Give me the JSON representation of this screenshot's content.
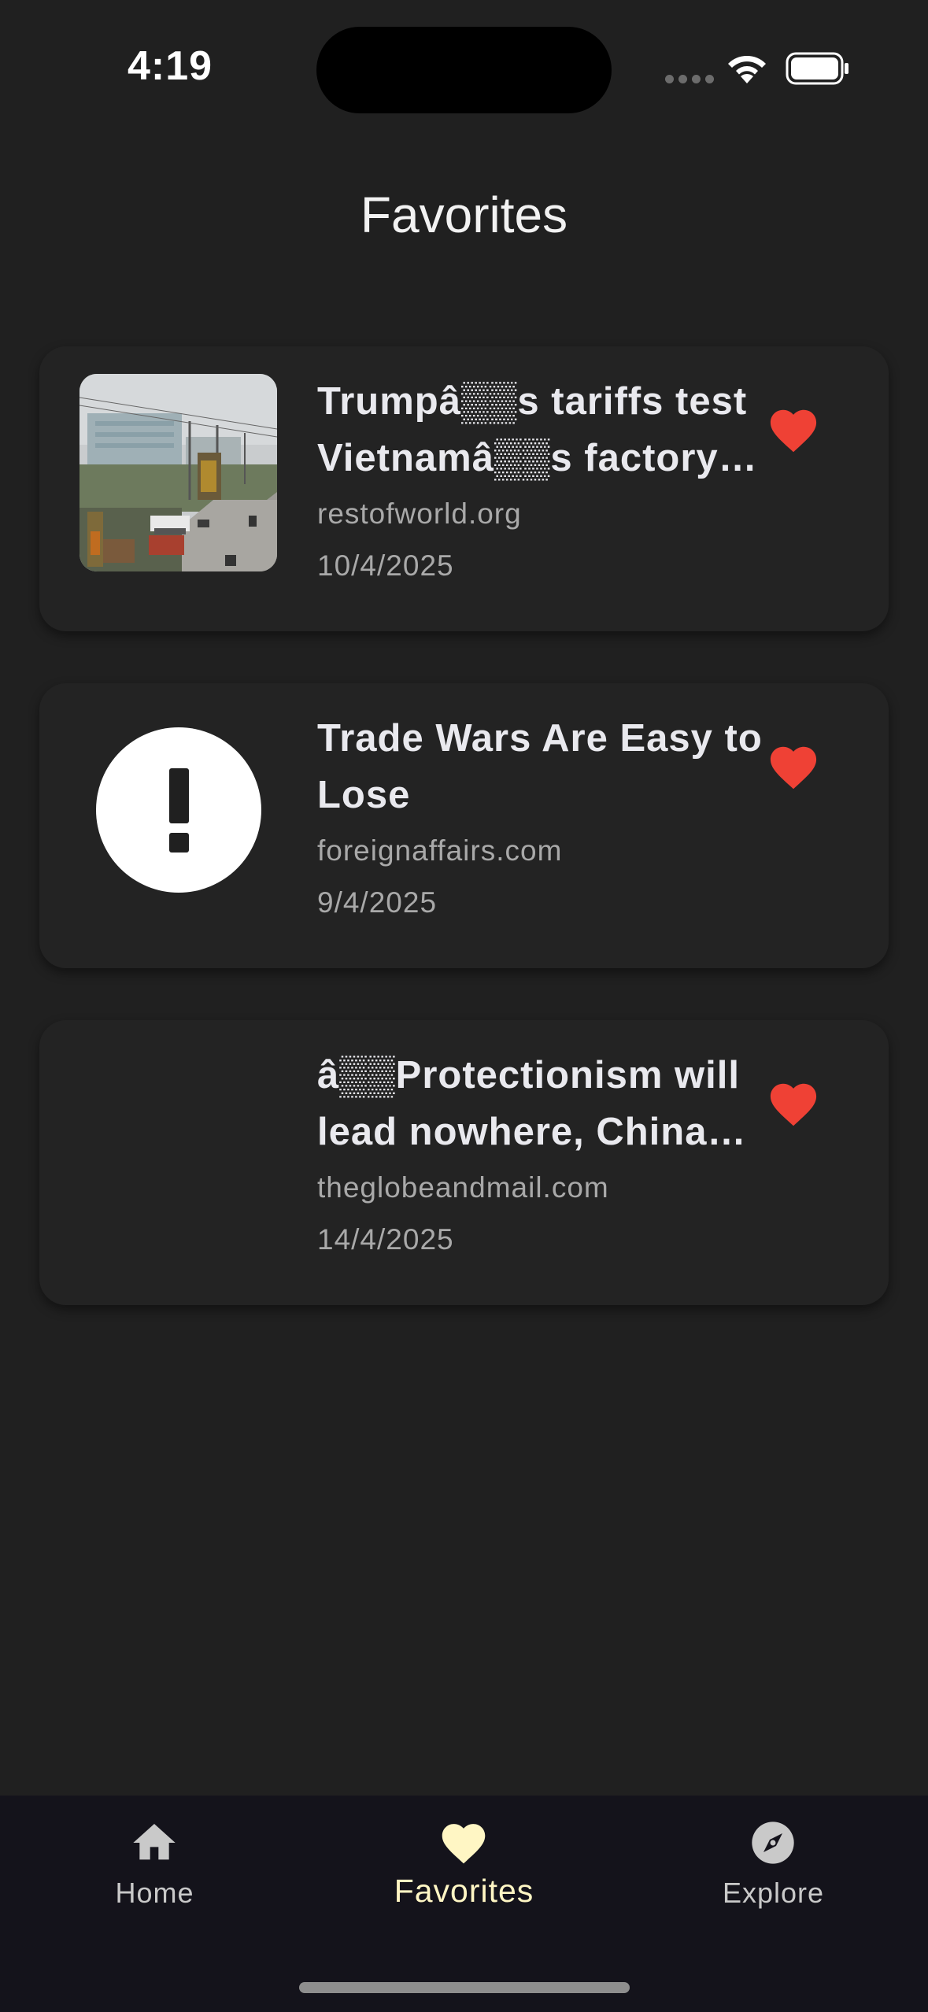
{
  "status_bar": {
    "time": "4:19"
  },
  "header": {
    "title": "Favorites"
  },
  "articles": [
    {
      "title": "Trumpâ▒▒s tariffs test Vietnamâ▒▒s factory boom",
      "source": "restofworld.org",
      "date": "10/4/2025",
      "thumbnail": "street-photo",
      "favorite": true
    },
    {
      "title": "Trade Wars Are Easy to Lose",
      "source": "foreignaffairs.com",
      "date": "9/4/2025",
      "thumbnail": "error-icon",
      "favorite": true
    },
    {
      "title": "â▒▒Protectionism will lead nowhere, China warns",
      "source": "theglobeandmail.com",
      "date": "14/4/2025",
      "thumbnail": "none",
      "favorite": true
    }
  ],
  "bottom_nav": {
    "items": [
      {
        "label": "Home",
        "icon": "home-icon",
        "active": false
      },
      {
        "label": "Favorites",
        "icon": "heart-icon",
        "active": true
      },
      {
        "label": "Explore",
        "icon": "compass-icon",
        "active": false
      }
    ]
  },
  "colors": {
    "background": "#202020",
    "card": "#232323",
    "heart": "#ef4135",
    "nav_background": "#14131b",
    "nav_active": "#fff6c4"
  }
}
